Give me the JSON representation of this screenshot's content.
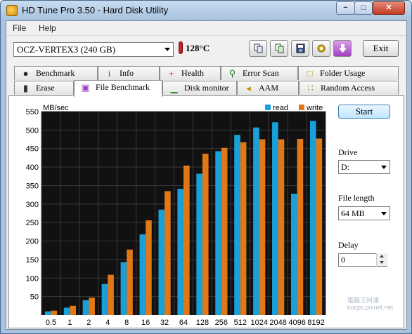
{
  "window": {
    "title": "HD Tune Pro 3.50 - Hard Disk Utility",
    "min_label": "−",
    "max_label": "□",
    "close_label": "✕"
  },
  "menu": {
    "file": "File",
    "help": "Help"
  },
  "toolbar": {
    "drive": "OCZ-VERTEX3 (240 GB)",
    "temperature": "128°C",
    "exit_label": "Exit",
    "icons": [
      "copy-icon",
      "copy-all-icon",
      "save-icon",
      "options-icon",
      "download-icon"
    ]
  },
  "tabs_top": [
    {
      "label": "Benchmark",
      "icon": "benchmark-icon"
    },
    {
      "label": "Info",
      "icon": "info-icon"
    },
    {
      "label": "Health",
      "icon": "health-icon"
    },
    {
      "label": "Error Scan",
      "icon": "error-scan-icon"
    },
    {
      "label": "Folder Usage",
      "icon": "folder-icon"
    }
  ],
  "tabs_bottom": [
    {
      "label": "Erase",
      "icon": "trash-icon"
    },
    {
      "label": "File Benchmark",
      "icon": "file-benchmark-icon",
      "active": true
    },
    {
      "label": "Disk monitor",
      "icon": "disk-monitor-icon"
    },
    {
      "label": "AAM",
      "icon": "speaker-icon"
    },
    {
      "label": "Random Access",
      "icon": "random-access-icon"
    }
  ],
  "right_pane": {
    "start_label": "Start",
    "drive_label": "Drive",
    "drive_value": "D:",
    "file_length_label": "File length",
    "file_length_value": "64 MB",
    "delay_label": "Delay",
    "delay_value": "0"
  },
  "watermark": {
    "line1": "電腦王阿達",
    "line2": "kocpc.pixnet.net"
  },
  "colors": {
    "read": "#1aa0d8",
    "write": "#e07818",
    "plot_bg": "#111111",
    "grid": "#3a3a3a"
  },
  "chart_data": {
    "type": "bar",
    "unit_label": "MB/sec",
    "categories": [
      "0.5",
      "1",
      "2",
      "4",
      "8",
      "16",
      "32",
      "64",
      "128",
      "256",
      "512",
      "1024",
      "2048",
      "4096",
      "8192"
    ],
    "series": [
      {
        "name": "read",
        "values": [
          10,
          20,
          40,
          84,
          143,
          218,
          285,
          341,
          382,
          443,
          487,
          507,
          521,
          328,
          525
        ]
      },
      {
        "name": "write",
        "values": [
          12,
          25,
          47,
          109,
          177,
          256,
          335,
          404,
          436,
          452,
          467,
          475,
          475,
          476,
          477
        ]
      }
    ],
    "ylim": [
      0,
      550
    ],
    "yticks": [
      50,
      100,
      150,
      200,
      250,
      300,
      350,
      400,
      450,
      500,
      550
    ],
    "grid": true,
    "legend": "top-right"
  }
}
